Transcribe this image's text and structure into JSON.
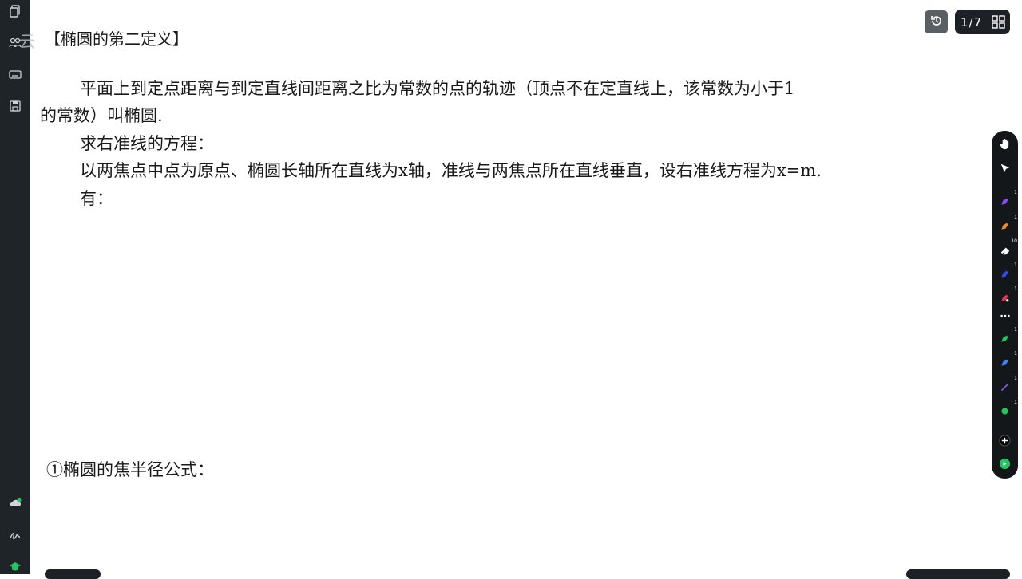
{
  "document": {
    "title": "【椭圆的第二定义】",
    "watermark": "云",
    "paragraph_line1": "平面上到定点距离与到定直线间距离之比为常数的点的轨迹（顶点不在定直线上，该常数为小于1",
    "paragraph_line2": "的常数）叫椭圆.",
    "line_directrix": "求右准线的方程：",
    "line_setup": "以两焦点中点为原点、椭圆长轴所在直线为x轴，准线与两焦点所在直线垂直，设右准线方程为x=m.",
    "line_have": "有：",
    "section_focal_radius": "①椭圆的焦半径公式："
  },
  "controls": {
    "page_indicator": "1/7"
  },
  "toolbar": {
    "badges": {
      "pen_purple": "1",
      "pen_orange": "1",
      "eraser": "10",
      "pen_blue": "1",
      "pen_red": "1",
      "pen_green": "1",
      "pen_lightblue": "1",
      "line_tool": "1",
      "circle_tool": "1"
    }
  },
  "colors": {
    "sidebar_bg": "#1f2428",
    "toolbar_bg": "#14171a",
    "pen_purple": "#8a4cf0",
    "pen_orange": "#f08a24",
    "pen_blue": "#2f4cf5",
    "pen_red": "#e8304a",
    "pen_green": "#22c55e",
    "pen_lightblue": "#3b82f6",
    "line_purple": "#8b5cf6"
  },
  "icons": [
    "copy-icon",
    "users-icon",
    "keyboard-icon",
    "save-icon",
    "cloud-icon",
    "signature-icon",
    "graduation-cap-icon",
    "history-icon",
    "grid-icon",
    "hand-icon",
    "pointer-icon",
    "pen-icon",
    "eraser-icon",
    "more-icon",
    "add-icon",
    "exit-icon"
  ]
}
